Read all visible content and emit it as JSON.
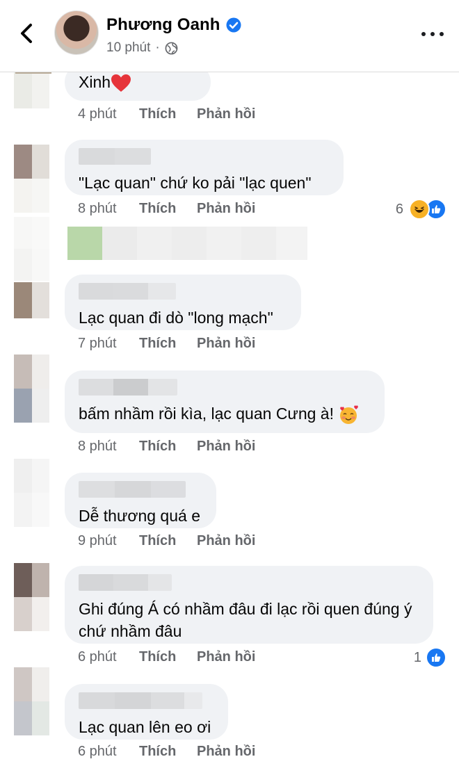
{
  "header": {
    "name": "Phương Oanh",
    "time": "10 phút",
    "separator": "·"
  },
  "actions": {
    "like": "Thích",
    "reply": "Phản hồi"
  },
  "comments": [
    {
      "text": "Xinh",
      "time": "4 phút",
      "emoji": "heart"
    },
    {
      "text": "\"Lạc quan\" chứ ko pải \"lạc quen\"",
      "time": "8 phút",
      "reaction_count": "6",
      "reactions": [
        "haha",
        "like"
      ]
    },
    {
      "text": "Lạc quan đi dò \"long mạch\"",
      "time": "7 phút"
    },
    {
      "text": "bấm nhầm rồi kìa, lạc quan Cưng à!",
      "time": "8 phút",
      "emoji": "smiling-face-with-hearts"
    },
    {
      "text": "Dễ thương quá e",
      "time": "9 phút"
    },
    {
      "text": "Ghi đúng Á có nhầm đâu đi lạc rồi quen đúng ý chứ nhầm đâu",
      "time": "6 phút",
      "reaction_count": "1",
      "reactions": [
        "like"
      ]
    },
    {
      "text": "Lạc quan lên eo ơi",
      "time": "6 phút"
    }
  ],
  "colors": {
    "bubble": "#f0f2f5",
    "secondary_text": "#65676b",
    "like_blue": "#1877f2",
    "verified_blue": "#1877f2"
  },
  "icons": [
    "back-arrow-icon",
    "verified-badge-icon",
    "globe-icon",
    "more-options-icon",
    "heart-emoji-icon",
    "haha-reaction-icon",
    "like-reaction-icon",
    "smiling-face-with-hearts-icon"
  ]
}
